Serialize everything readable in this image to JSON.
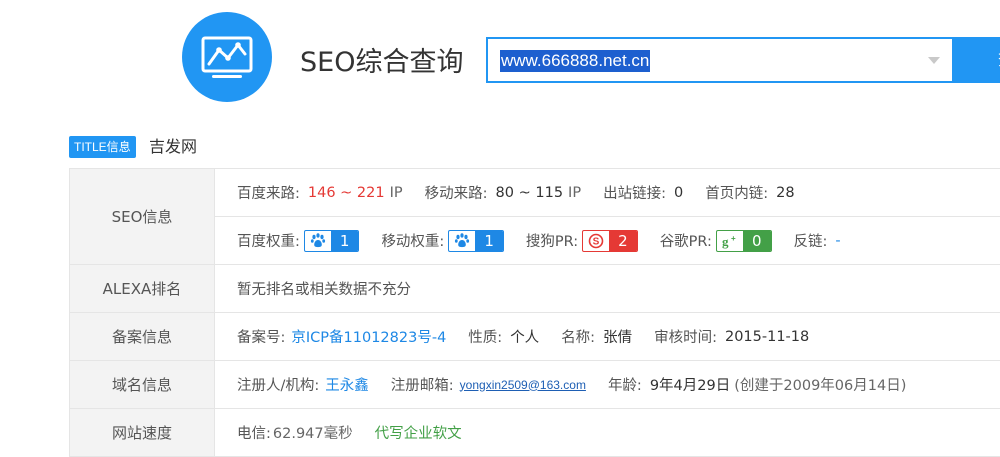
{
  "header": {
    "title": "SEO综合查询",
    "search_value": "www.666888.net.cn",
    "search_button_label": "查询"
  },
  "title_info": {
    "badge": "TITLE信息",
    "value": "吉发网"
  },
  "seo": {
    "label": "SEO信息",
    "baidu_traffic_label": "百度来路:",
    "baidu_traffic_value": "146 ~ 221",
    "baidu_traffic_unit": "IP",
    "mobile_traffic_label": "移动来路:",
    "mobile_traffic_value": "80 ~ 115",
    "mobile_traffic_unit": "IP",
    "outbound_links_label": "出站链接:",
    "outbound_links_value": "0",
    "home_internal_links_label": "首页内链:",
    "home_internal_links_value": "28",
    "baidu_weight_label": "百度权重:",
    "baidu_weight_value": "1",
    "mobile_weight_label": "移动权重:",
    "mobile_weight_value": "1",
    "sogou_pr_label": "搜狗PR:",
    "sogou_pr_value": "2",
    "google_pr_label": "谷歌PR:",
    "google_pr_value": "0",
    "backlinks_label": "反链:",
    "backlinks_value": "-"
  },
  "alexa": {
    "label": "ALEXA排名",
    "value": "暂无排名或相关数据不充分"
  },
  "icp": {
    "label": "备案信息",
    "number_label": "备案号:",
    "number_value": "京ICP备11012823号-4",
    "nature_label": "性质:",
    "nature_value": "个人",
    "name_label": "名称:",
    "name_value": "张倩",
    "audit_label": "审核时间:",
    "audit_value": "2015-11-18"
  },
  "domain": {
    "label": "域名信息",
    "registrant_label": "注册人/机构:",
    "registrant_value": "王永鑫",
    "email_label": "注册邮箱:",
    "email_value": "yongxin2509@163.com",
    "age_label": "年龄:",
    "age_value": "9年4月29日",
    "created_note": "(创建于2009年06月14日)"
  },
  "speed": {
    "label": "网站速度",
    "telecom_label": "电信:",
    "telecom_value": "62.947毫秒",
    "ad_link": "代写企业软文"
  },
  "icons": {
    "logo": "chart-monitor-icon",
    "dropdown": "chevron-down-icon",
    "baidu": "baidu-paw-icon",
    "sogou": "sogou-icon",
    "google": "google-plus-icon"
  },
  "colors": {
    "accent": "#2196f3",
    "red": "#e53935",
    "green": "#43a047"
  }
}
